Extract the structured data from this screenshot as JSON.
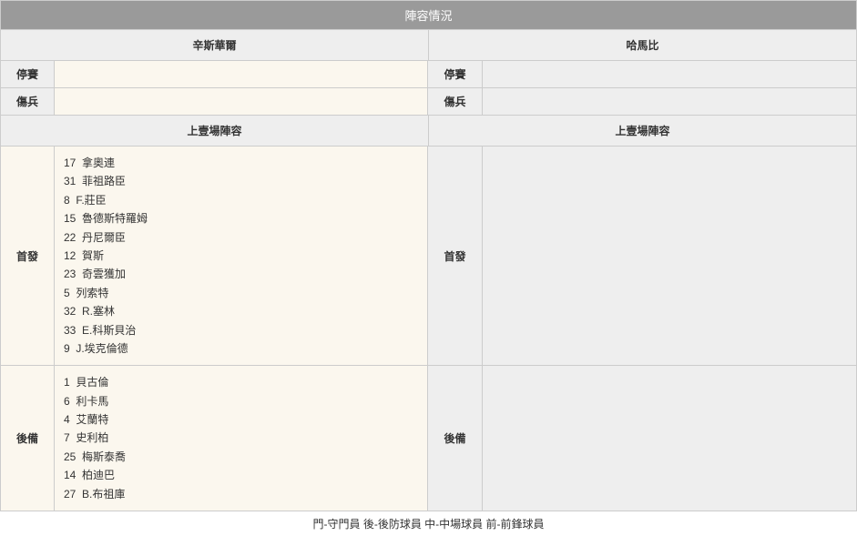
{
  "title": "陣容情況",
  "teams": {
    "left": "辛斯華爾",
    "right": "哈馬比"
  },
  "labels": {
    "suspended": "停賽",
    "injured": "傷兵",
    "lastLineup": "上壹場陣容",
    "starting": "首發",
    "subs": "後備"
  },
  "left": {
    "suspended": "",
    "injured": "",
    "starting": [
      {
        "no": "17",
        "name": "拿奧連"
      },
      {
        "no": "31",
        "name": "菲祖路臣"
      },
      {
        "no": "8",
        "name": "F.莊臣"
      },
      {
        "no": "15",
        "name": "魯德斯特羅姆"
      },
      {
        "no": "22",
        "name": "丹尼爾臣"
      },
      {
        "no": "12",
        "name": "賀斯"
      },
      {
        "no": "23",
        "name": "奇雲獲加"
      },
      {
        "no": "5",
        "name": "列索特"
      },
      {
        "no": "32",
        "name": "R.塞林"
      },
      {
        "no": "33",
        "name": "E.科斯貝治"
      },
      {
        "no": "9",
        "name": "J.埃克倫德"
      }
    ],
    "subs": [
      {
        "no": "1",
        "name": "貝古倫"
      },
      {
        "no": "6",
        "name": "利卡馬"
      },
      {
        "no": "4",
        "name": "艾蘭特"
      },
      {
        "no": "7",
        "name": "史利柏"
      },
      {
        "no": "25",
        "name": "梅斯泰喬"
      },
      {
        "no": "14",
        "name": "柏迪巴"
      },
      {
        "no": "27",
        "name": "B.布祖庫"
      }
    ]
  },
  "right": {
    "suspended": "",
    "injured": "",
    "starting": [],
    "subs": []
  },
  "legend": "門-守門員 後-後防球員 中-中場球員 前-前鋒球員"
}
